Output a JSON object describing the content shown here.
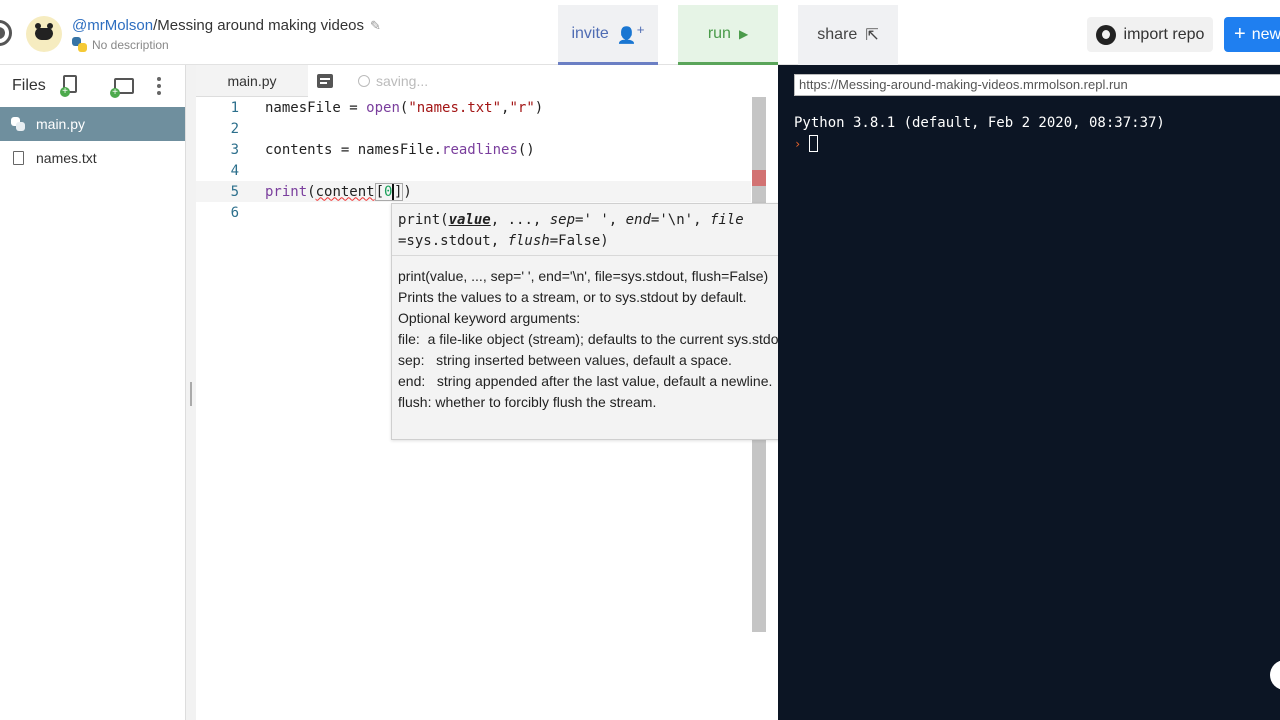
{
  "header": {
    "user": "@mrMolson",
    "separator": "/",
    "repl_name": "Messing around making videos",
    "description": "No description",
    "invite_label": "invite",
    "invite_icon": "+",
    "run_label": "run",
    "run_icon": "▶",
    "share_label": "share",
    "import_label": "import repo",
    "new_label": "new",
    "new_icon": "+"
  },
  "sidebar": {
    "title": "Files",
    "files": [
      {
        "name": "main.py",
        "active": true,
        "icon": "python-file-icon"
      },
      {
        "name": "names.txt",
        "active": false,
        "icon": "text-file-icon"
      }
    ]
  },
  "editor": {
    "tab": "main.py",
    "status": "saving...",
    "line_numbers": [
      "1",
      "2",
      "3",
      "4",
      "5",
      "6"
    ],
    "lines": [
      "namesFile = open(\"names.txt\",\"r\")",
      "",
      "contents = namesFile.readlines()",
      "",
      "print(content[0])",
      ""
    ]
  },
  "tooltip": {
    "signature_line1": "print(value, ..., sep=' ', end='\\n', file",
    "signature_line2": "=sys.stdout, flush=False)",
    "doc": [
      "print(value, ..., sep=' ', end='\\n', file=sys.stdout, flush=False)",
      "",
      "Prints the values to a stream, or to sys.stdout by default.",
      "Optional keyword arguments:",
      "file:  a file-like object (stream); defaults to the current sys.stdout.",
      "sep:   string inserted between values, default a space.",
      "end:   string appended after the last value, default a newline.",
      "flush: whether to forcibly flush the stream."
    ]
  },
  "console": {
    "url": "https://Messing-around-making-videos.mrmolson.repl.run",
    "banner": "Python 3.8.1 (default, Feb  2 2020, 08:37:37)",
    "prompt": "›"
  },
  "colors": {
    "active_file_bg": "#6f8f9e",
    "console_bg": "#0c1524",
    "invite_accent": "#4f6cb3",
    "run_accent": "#4a9b4a",
    "new_button": "#1f7ff0"
  }
}
